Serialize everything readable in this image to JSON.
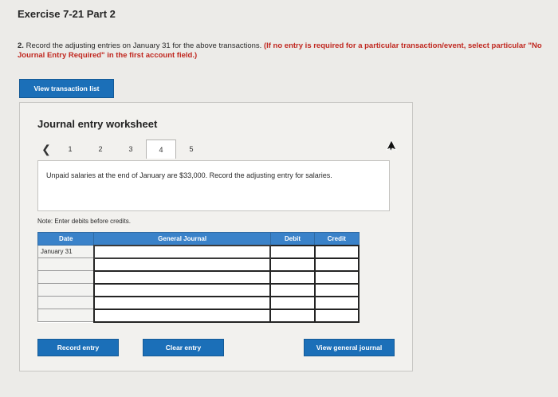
{
  "page": {
    "title": "Exercise 7-21 Part 2",
    "instruction_number": "2.",
    "instruction_text": "Record the adjusting entries on January 31 for the above transactions.",
    "instruction_red": "(If no entry is required for a particular transaction/event, select particular \"No Journal Entry Required\" in the first account field.)"
  },
  "buttons": {
    "view_transaction_list": "View transaction list",
    "record_entry": "Record entry",
    "clear_entry": "Clear entry",
    "view_general_journal": "View general journal"
  },
  "worksheet": {
    "title": "Journal entry worksheet",
    "pages": [
      "1",
      "2",
      "3",
      "4",
      "5"
    ],
    "active_page": "4",
    "question": "Unpaid salaries at the end of January are $33,000. Record the adjusting entry for salaries.",
    "note": "Note: Enter debits before credits."
  },
  "journal": {
    "headers": {
      "date": "Date",
      "general_journal": "General Journal",
      "debit": "Debit",
      "credit": "Credit"
    },
    "rows": [
      {
        "date": "January 31",
        "account": "",
        "debit": "",
        "credit": ""
      },
      {
        "date": "",
        "account": "",
        "debit": "",
        "credit": ""
      },
      {
        "date": "",
        "account": "",
        "debit": "",
        "credit": ""
      },
      {
        "date": "",
        "account": "",
        "debit": "",
        "credit": ""
      },
      {
        "date": "",
        "account": "",
        "debit": "",
        "credit": ""
      },
      {
        "date": "",
        "account": "",
        "debit": "",
        "credit": ""
      }
    ]
  },
  "colors": {
    "accent_blue": "#1b6fb8",
    "header_blue": "#3a82c9",
    "instruction_red": "#c0271f"
  },
  "icons": {
    "prev": "chevron-left-icon",
    "cursor": "mouse-pointer-icon"
  }
}
